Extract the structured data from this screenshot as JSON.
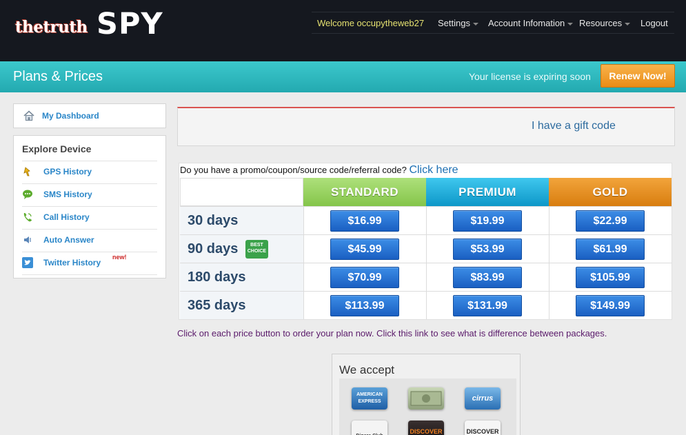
{
  "logo": {
    "small": "thetruth",
    "big": "SPY"
  },
  "topnav": {
    "welcome": "Welcome occupytheweb27",
    "settings": "Settings",
    "account": "Account Infomation",
    "resources": "Resources",
    "logout": "Logout"
  },
  "header": {
    "title": "Plans & Prices",
    "expiring": "Your license is expiring soon",
    "renew": "Renew Now!"
  },
  "sidebar": {
    "dashboard": "My Dashboard",
    "explore_title": "Explore Device",
    "items": [
      {
        "label": "GPS History",
        "icon": "gps-icon"
      },
      {
        "label": "SMS History",
        "icon": "sms-icon"
      },
      {
        "label": "Call History",
        "icon": "phone-icon"
      },
      {
        "label": "Auto Answer",
        "icon": "speaker-icon"
      },
      {
        "label": "Twitter History",
        "icon": "twitter-icon",
        "badge": "new!"
      }
    ]
  },
  "gift": {
    "label": "I have a gift code"
  },
  "promo": {
    "question": "Do you have a promo/coupon/source code/referral code?",
    "link": "Click here"
  },
  "plans": {
    "headers": [
      "STANDARD",
      "PREMIUM",
      "GOLD"
    ],
    "best_badge": "BEST CHOICE",
    "rows": [
      {
        "duration": "30 days",
        "prices": [
          "$16.99",
          "$19.99",
          "$22.99"
        ]
      },
      {
        "duration": "90 days",
        "prices": [
          "$45.99",
          "$53.99",
          "$61.99"
        ]
      },
      {
        "duration": "180 days",
        "prices": [
          "$70.99",
          "$83.99",
          "$105.99"
        ]
      },
      {
        "duration": "365 days",
        "prices": [
          "$113.99",
          "$131.99",
          "$149.99"
        ]
      }
    ]
  },
  "note": "Click on each price button to order your plan now. Click this link to see what is difference between packages.",
  "accept": {
    "title": "We accept",
    "cards": [
      "AMERICAN EXPRESS",
      "cirrus",
      "Diners Club",
      "DISCOVER"
    ]
  },
  "colors": {
    "accent_teal": "#2bb5bb",
    "renew_orange": "#ee961f",
    "price_blue": "#2474d8"
  }
}
